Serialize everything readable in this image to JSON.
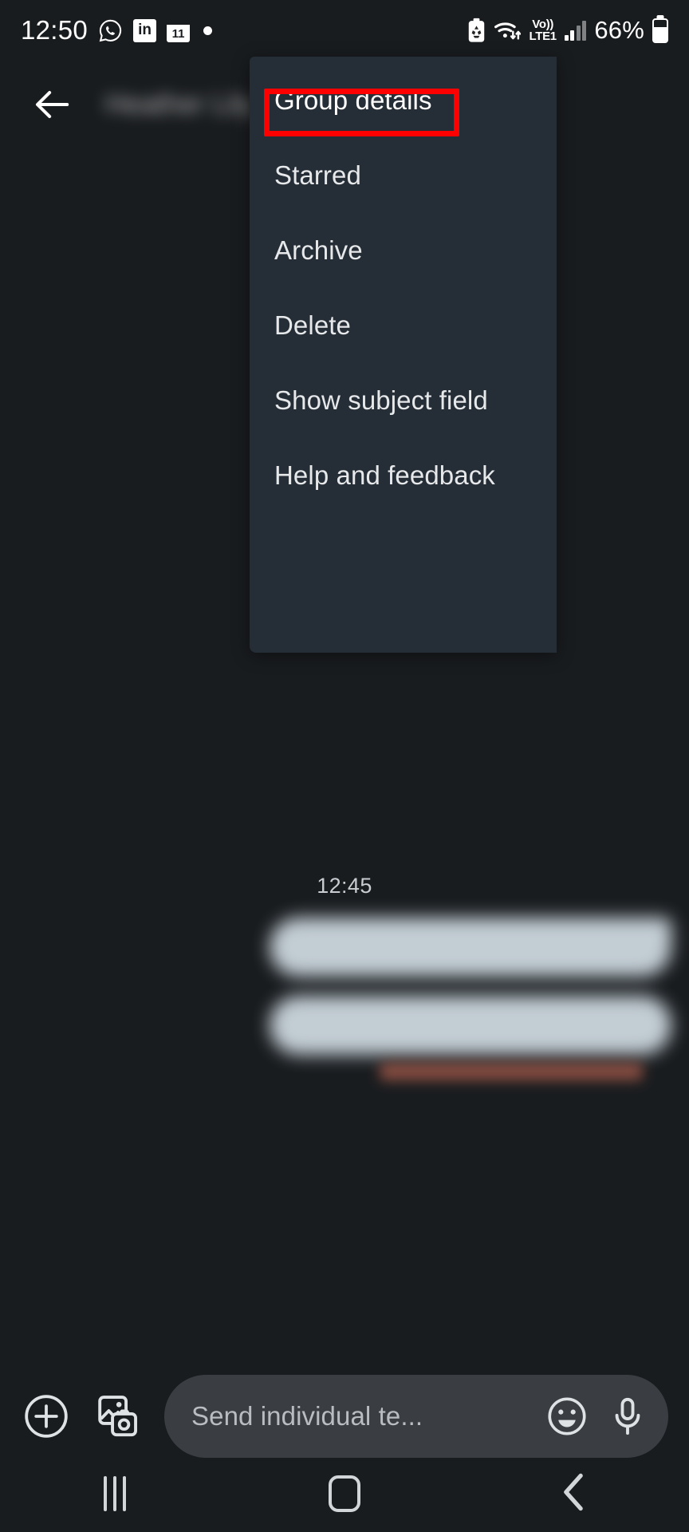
{
  "status_bar": {
    "time": "12:50",
    "battery_percent": "66%",
    "network_label_top": "Vo))",
    "network_label_bottom": "LTE1",
    "calendar_day": "11",
    "left_icons": [
      "whatsapp-icon",
      "linkedin-icon",
      "calendar-icon",
      "notification-dot-icon"
    ],
    "right_icons": [
      "battery-saver-icon",
      "wifi-icon",
      "volte-icon",
      "signal-bars-icon",
      "battery-icon"
    ],
    "linkedin_label": "in"
  },
  "app_bar": {
    "back_label": "back-arrow",
    "conversation_title": "Heather Lily"
  },
  "overflow_menu": {
    "items": [
      {
        "id": "group-details",
        "label": "Group details",
        "highlighted": true
      },
      {
        "id": "starred",
        "label": "Starred",
        "highlighted": false
      },
      {
        "id": "archive",
        "label": "Archive",
        "highlighted": false
      },
      {
        "id": "delete",
        "label": "Delete",
        "highlighted": false
      },
      {
        "id": "show-subject-field",
        "label": "Show subject field",
        "highlighted": false
      },
      {
        "id": "help-and-feedback",
        "label": "Help and feedback",
        "highlighted": false
      }
    ],
    "background_color": "#252d36",
    "highlight_color": "#fe0000"
  },
  "conversation": {
    "timestamp": "12:45",
    "messages": [
      {
        "id": "message-1",
        "direction": "outgoing",
        "obscured": true
      },
      {
        "id": "message-2",
        "direction": "outgoing",
        "obscured": true
      }
    ],
    "delivery_status_obscured": true,
    "bubble_color": "#ccd7de"
  },
  "compose_bar": {
    "placeholder": "Send individual te...",
    "attach_icon": "plus-icon",
    "gallery_icon": "gallery-camera-icon",
    "emoji_icon": "emoji-smiley-icon",
    "mic_icon": "microphone-icon"
  },
  "nav_bar": {
    "recents_label": "recents",
    "home_label": "home",
    "back_label": "back"
  },
  "theme": {
    "background": "#191c1f",
    "surface": "#252d36",
    "text_primary": "#e6e8ea",
    "accent_red": "#fe0000"
  }
}
